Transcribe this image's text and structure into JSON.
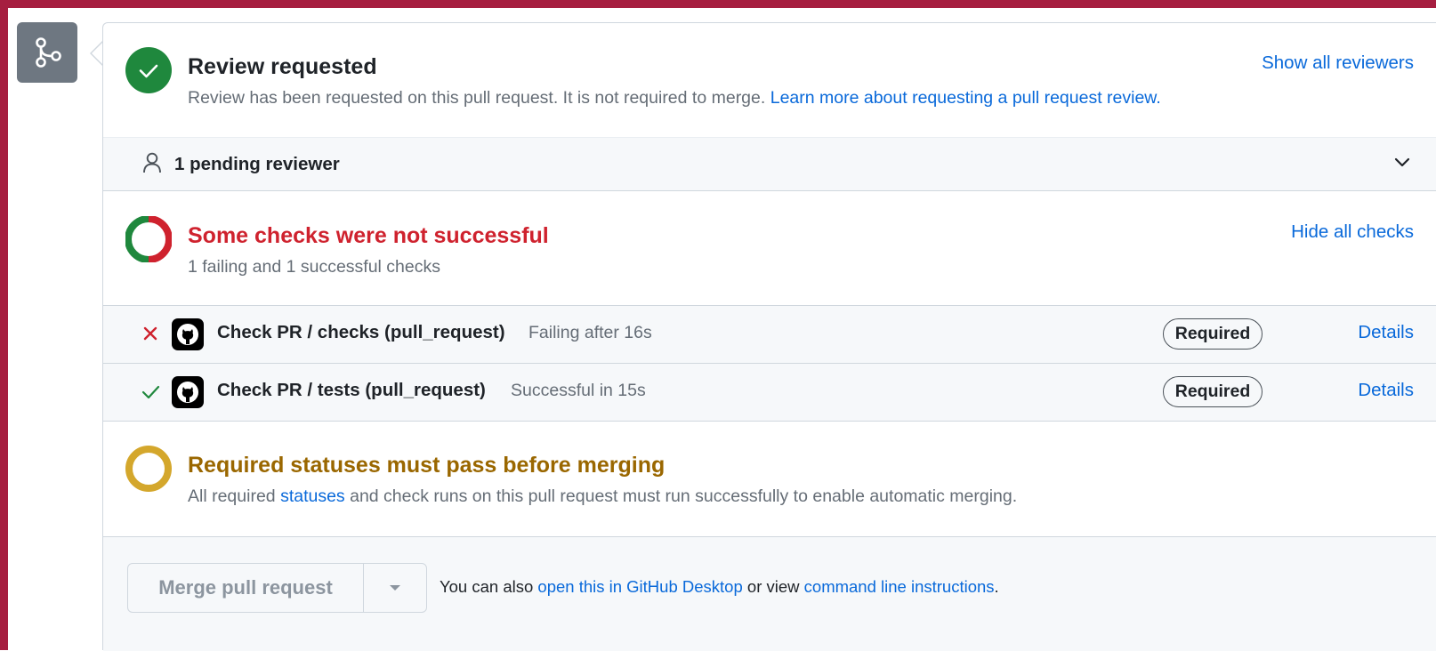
{
  "review": {
    "title": "Review requested",
    "description": "Review has been requested on this pull request. It is not required to merge.",
    "learn_more_link": "Learn more about requesting a pull request review.",
    "show_all_link": "Show all reviewers",
    "pending_label": "1 pending reviewer"
  },
  "checks": {
    "title": "Some checks were not successful",
    "summary": "1 failing and 1 successful checks",
    "hide_all_link": "Hide all checks",
    "items": [
      {
        "status": "failing",
        "name": "Check PR / checks (pull_request)",
        "meta": "Failing after 16s",
        "badge": "Required",
        "details": "Details"
      },
      {
        "status": "success",
        "name": "Check PR / tests (pull_request)",
        "meta": "Successful in 15s",
        "badge": "Required",
        "details": "Details"
      }
    ]
  },
  "required": {
    "title": "Required statuses must pass before merging",
    "desc_prefix": "All required ",
    "desc_link": "statuses",
    "desc_suffix": " and check runs on this pull request must run successfully to enable automatic merging."
  },
  "merge": {
    "button_label": "Merge pull request",
    "note_prefix": "You can also ",
    "desktop_link": "open this in GitHub Desktop",
    "note_middle": " or view ",
    "cli_link": "command line instructions",
    "note_suffix": "."
  },
  "colors": {
    "frame": "#a61e40",
    "success": "#1f883d",
    "danger": "#cf222e",
    "attention": "#9a6700",
    "attention_ring": "#d4a72c",
    "link": "#0969da",
    "badge_bg": "#6e7781"
  },
  "icons": {
    "badge": "git-merge-icon",
    "review": "check-circle-icon",
    "pending": "person-icon",
    "expand": "chevron-down-icon",
    "checks": "failure-donut-icon",
    "failing": "x-icon",
    "success": "check-icon",
    "app": "github-mark-icon",
    "required": "pending-ring-icon",
    "merge_caret": "triangle-down-icon"
  }
}
